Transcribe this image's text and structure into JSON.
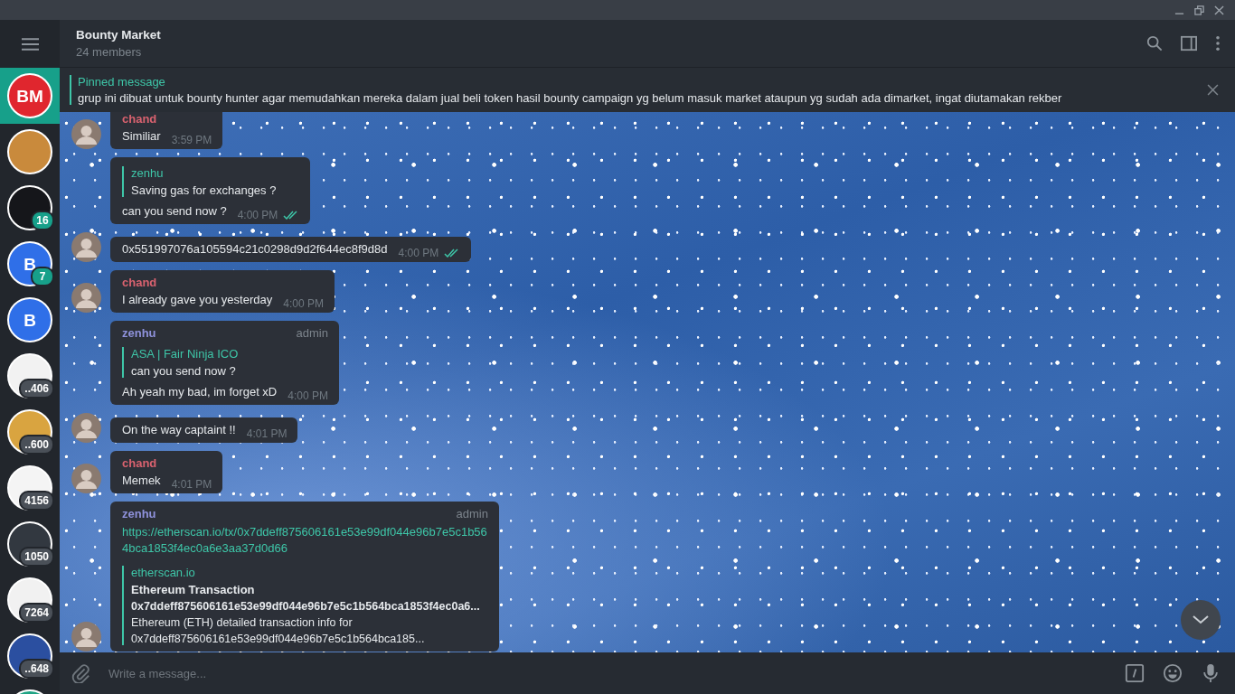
{
  "chats": [
    {
      "initials": "BM",
      "color": "#e0262e",
      "selected": true
    },
    {
      "color": "#c98a3c",
      "selected": false
    },
    {
      "color": "#15161a",
      "selected": false,
      "badge": {
        "text": "16",
        "muted": false
      }
    },
    {
      "initials": "B",
      "color": "#2f6fe8",
      "selected": false,
      "badge": {
        "text": "7",
        "muted": false
      }
    },
    {
      "initials": "B",
      "color": "#2f6fe8",
      "selected": false
    },
    {
      "color": "#f2f2f2",
      "selected": false,
      "badge": {
        "text": "..406",
        "muted": true
      }
    },
    {
      "color": "#d9a440",
      "selected": false,
      "badge": {
        "text": "..600",
        "muted": true
      }
    },
    {
      "color": "#f4f4f4",
      "selected": false,
      "badge": {
        "text": "4156",
        "muted": true
      }
    },
    {
      "color": "#323840",
      "selected": false,
      "badge": {
        "text": "1050",
        "muted": true
      }
    },
    {
      "color": "#f1f1f1",
      "selected": false,
      "badge": {
        "text": "7264",
        "muted": true
      }
    },
    {
      "color": "#2b4fa0",
      "selected": false,
      "badge": {
        "text": "..648",
        "muted": true
      }
    },
    {
      "color": "#1fa383",
      "selected": false
    }
  ],
  "header": {
    "title": "Bounty Market",
    "subtitle": "24 members"
  },
  "pinned": {
    "label": "Pinned message",
    "text": "grup ini dibuat untuk bounty hunter agar memudahkan mereka dalam jual beli token hasil bounty campaign yg belum masuk market ataupun yg sudah ada dimarket, ingat diutamakan rekber"
  },
  "messages": [
    {
      "kind": "text",
      "sender": {
        "name": "chand",
        "color": "#d9626f"
      },
      "text": "Similiar",
      "time": "3:59 PM",
      "read": false,
      "avatar": true
    },
    {
      "kind": "text",
      "reply": {
        "name": "zenhu",
        "text": "Saving gas for exchanges ?"
      },
      "text": "can you send now ?",
      "time": "4:00 PM",
      "read": true
    },
    {
      "kind": "text",
      "text": "0x551997076a105594c21c0298d9d2f644ec8f9d8d",
      "time": "4:00 PM",
      "read": true,
      "avatar": true
    },
    {
      "kind": "text",
      "sender": {
        "name": "chand",
        "color": "#d9626f"
      },
      "text": "I already gave you yesterday",
      "time": "4:00 PM",
      "read": false,
      "avatar": true
    },
    {
      "kind": "text",
      "sender": {
        "name": "zenhu",
        "color": "#8f92dc"
      },
      "admin": "admin",
      "reply": {
        "name": "ASA | Fair Ninja ICO",
        "text": "can you send now ?"
      },
      "text": "Ah yeah my bad, im forget xD",
      "time": "4:00 PM",
      "read": false
    },
    {
      "kind": "text",
      "text": "On the way captaint !!",
      "time": "4:01 PM",
      "read": false,
      "avatar": true
    },
    {
      "kind": "text",
      "sender": {
        "name": "chand",
        "color": "#d9626f"
      },
      "text": "Memek",
      "time": "4:01 PM",
      "read": false,
      "avatar": true
    },
    {
      "kind": "link",
      "sender": {
        "name": "zenhu",
        "color": "#8f92dc"
      },
      "admin": "admin",
      "text": "https://etherscan.io/tx/0x7ddeff875606161e53e99df044e96b7e5c1b564bca1853f4ec0a6e3aa37d0d66",
      "preview": {
        "site": "etherscan.io",
        "title": "Ethereum Transaction",
        "lines": [
          "0x7ddeff875606161e53e99df044e96b7e5c1b564bca1853f4ec0a6...",
          "Ethereum (ETH) detailed transaction info for",
          "0x7ddeff875606161e53e99df044e96b7e5c1b564bca185..."
        ]
      },
      "avatar": true
    }
  ],
  "composer": {
    "placeholder": "Write a message..."
  }
}
